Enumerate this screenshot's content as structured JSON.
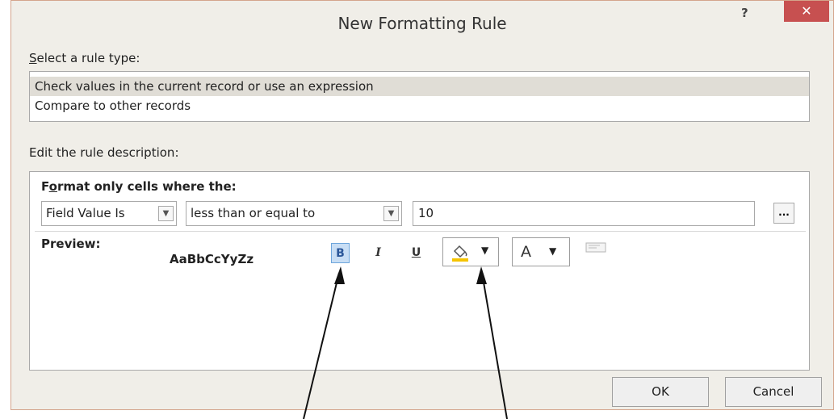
{
  "dialog": {
    "title": "New Formatting Rule",
    "help": "?",
    "close": "✕"
  },
  "rule_type": {
    "label_accel": "S",
    "label_rest": "elect a rule type:",
    "items": [
      "Check values in the current record or use an expression",
      "Compare to other records"
    ],
    "selected_index": 0
  },
  "description": {
    "label": "Edit the rule description:",
    "format_label_pre": "F",
    "format_label_accel": "o",
    "format_label_rest": "rmat only cells where the:",
    "field_combo": "Field Value Is",
    "operator_combo": "less than or equal to",
    "value": "10",
    "builder_button": "...",
    "preview_label": "Preview:",
    "preview_text": "AaBbCcYyZz",
    "bold_button": "B",
    "italic_button": "I",
    "underline_button": "U",
    "font_color_button": "A",
    "bold_active": true
  },
  "buttons": {
    "ok": "OK",
    "cancel": "Cancel"
  },
  "colors": {
    "close_red": "#c75050",
    "bold_highlight": "#c8def5",
    "fill_yellow": "#f5c400"
  },
  "icons": [
    "help-icon",
    "close-icon",
    "fill-color-icon",
    "dropdown-arrow-icon",
    "builder-ellipsis-icon",
    "conditional-format-icon"
  ]
}
